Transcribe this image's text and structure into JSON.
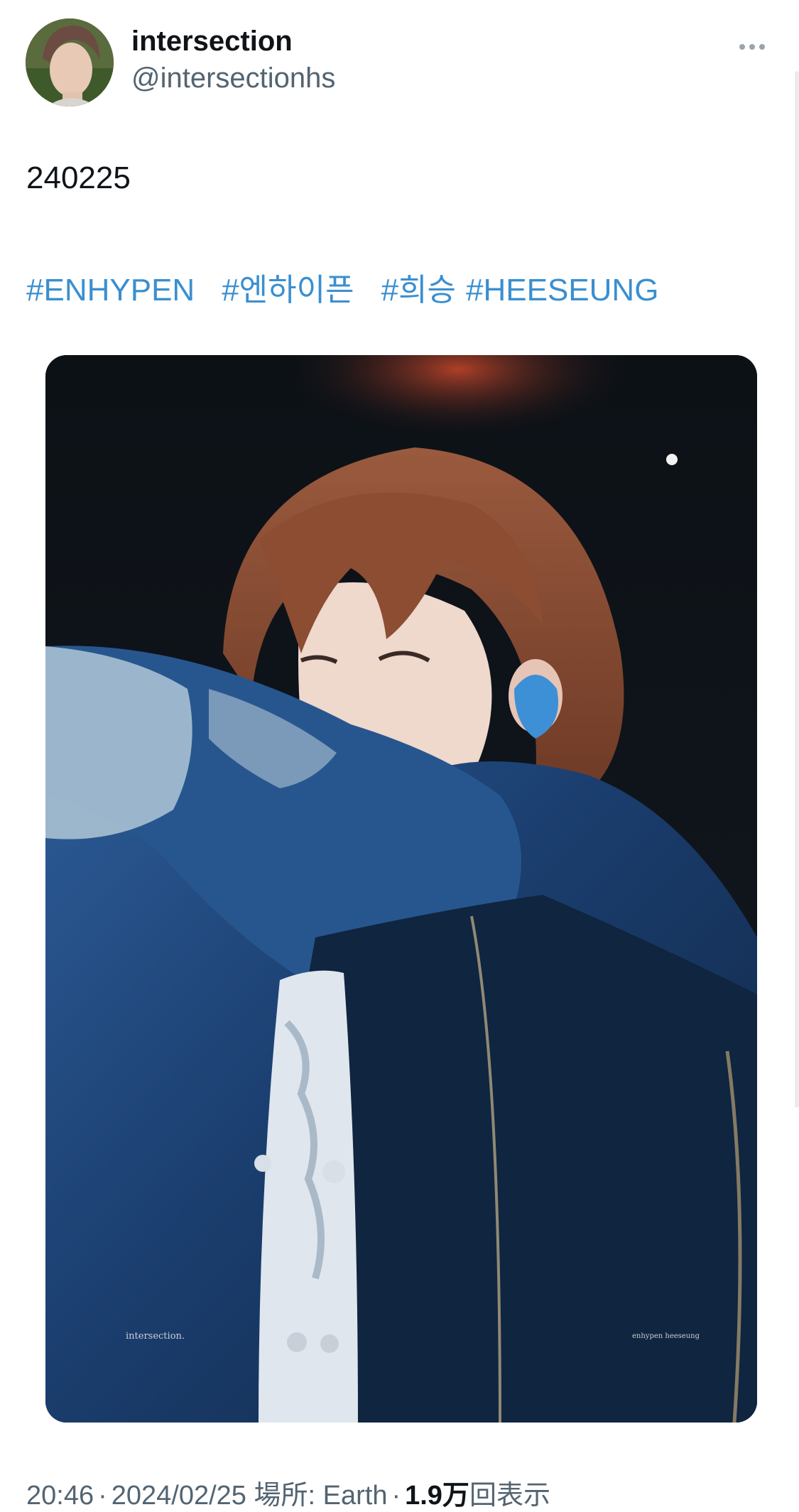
{
  "author": {
    "display_name": "intersection",
    "handle": "@intersectionhs"
  },
  "tweet": {
    "text": "240225",
    "hashtags": [
      "#ENHYPEN",
      "#엔하이픈",
      "#희승",
      "#HEESEUNG"
    ],
    "media": {
      "watermark_left": "intersection.",
      "watermark_right": "enhypen heeseung"
    }
  },
  "meta": {
    "time": "20:46",
    "separator": "·",
    "date": "2024/02/25",
    "location_label": "場所:",
    "location": "Earth",
    "views_count": "1.9万",
    "views_label": "回表示"
  },
  "icons": {
    "more": "more-dots-icon"
  },
  "colors": {
    "hashtag": "#3a8fd0",
    "secondary_text": "#536471",
    "primary_text": "#0f1419"
  }
}
